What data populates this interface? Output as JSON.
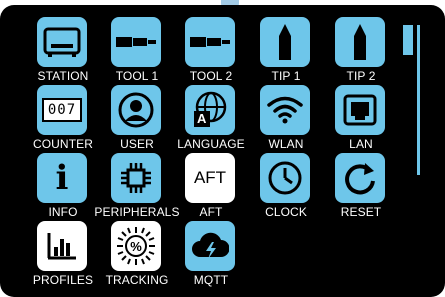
{
  "menu": {
    "items": [
      {
        "label": "STATION",
        "icon": "station-icon"
      },
      {
        "label": "TOOL 1",
        "icon": "tool-icon"
      },
      {
        "label": "TOOL 2",
        "icon": "tool-icon"
      },
      {
        "label": "TIP 1",
        "icon": "tip-icon"
      },
      {
        "label": "TIP 2",
        "icon": "tip-icon"
      },
      {
        "label": "COUNTER",
        "icon": "counter-icon",
        "counter_value": "007"
      },
      {
        "label": "USER",
        "icon": "user-icon"
      },
      {
        "label": "LANGUAGE",
        "icon": "language-icon",
        "glyph": "A"
      },
      {
        "label": "WLAN",
        "icon": "wifi-icon"
      },
      {
        "label": "LAN",
        "icon": "ethernet-icon"
      },
      {
        "label": "INFO",
        "icon": "info-icon",
        "glyph": "i"
      },
      {
        "label": "PERIPHERALS",
        "icon": "chip-icon"
      },
      {
        "label": "AFT",
        "icon": "aft-icon",
        "glyph": "AFT"
      },
      {
        "label": "CLOCK",
        "icon": "clock-icon"
      },
      {
        "label": "RESET",
        "icon": "reset-icon"
      },
      {
        "label": "PROFILES",
        "icon": "profiles-icon"
      },
      {
        "label": "TRACKING",
        "icon": "tracking-icon",
        "glyph": "%"
      },
      {
        "label": "MQTT",
        "icon": "mqtt-icon"
      }
    ]
  },
  "colors": {
    "accent": "#6ec6ea",
    "background": "#000000",
    "text": "#ffffff"
  }
}
